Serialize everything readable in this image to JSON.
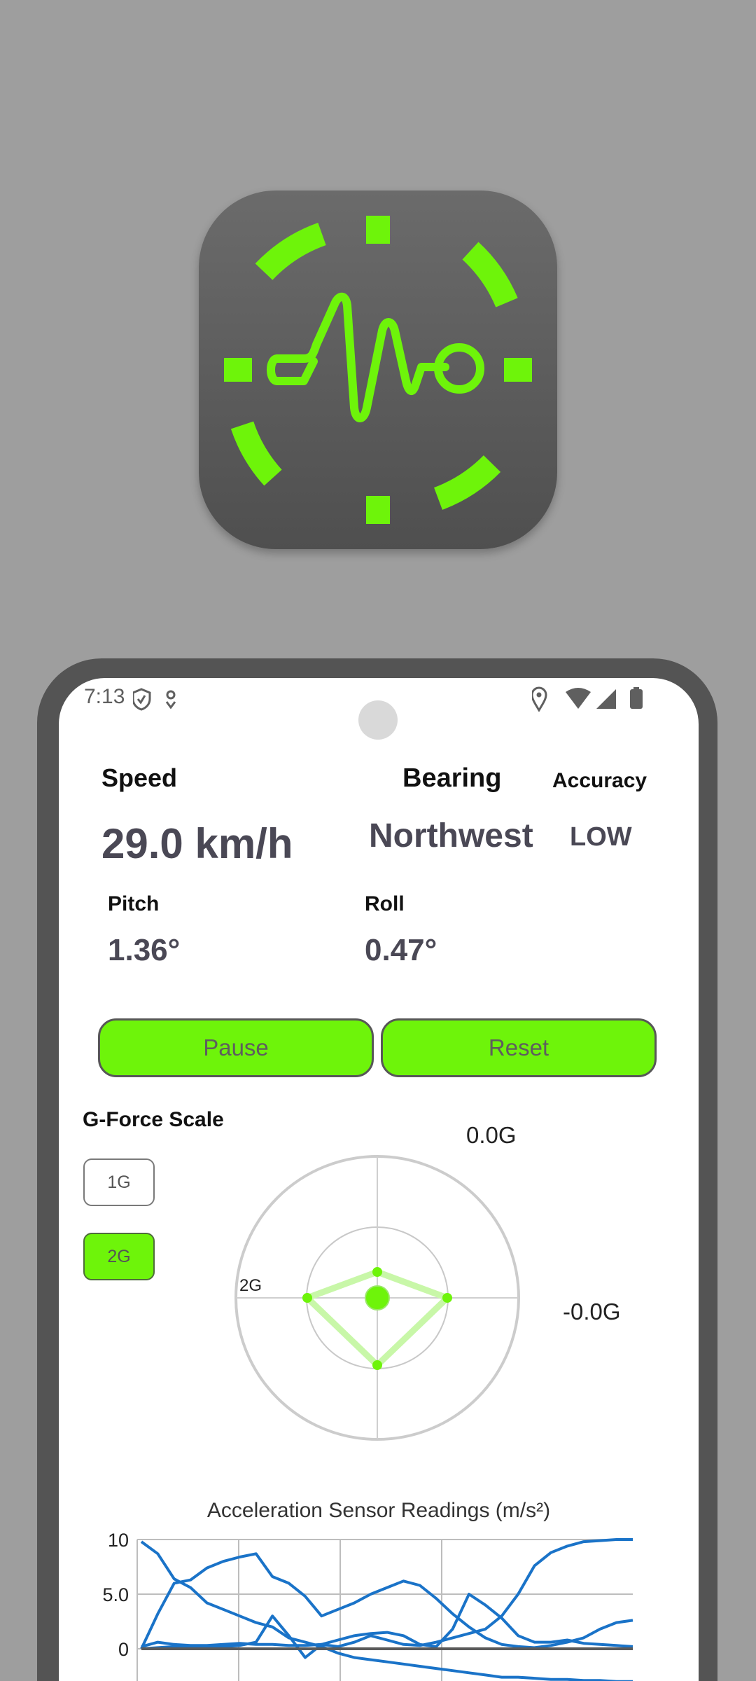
{
  "status_bar": {
    "time": "7:13"
  },
  "metrics": {
    "speed_label": "Speed",
    "speed_value": "29.0 km/h",
    "bearing_label": "Bearing",
    "bearing_value": "Northwest",
    "accuracy_label": "Accuracy",
    "accuracy_value": "LOW",
    "pitch_label": "Pitch",
    "pitch_value": "1.36°",
    "roll_label": "Roll",
    "roll_value": "0.47°"
  },
  "controls": {
    "pause_label": "Pause",
    "reset_label": "Reset"
  },
  "gforce": {
    "scale_title": "G-Force Scale",
    "scale_options": [
      "1G",
      "2G"
    ],
    "selected_scale": "2G",
    "top_readout": "0.0G",
    "side_readout": "-0.0G",
    "ring_label": "2G"
  },
  "chart_data": {
    "type": "line",
    "title": "Acceleration Sensor Readings (m/s²)",
    "y_tick_labels": [
      "10",
      "5.0",
      "0"
    ],
    "ylim": [
      0,
      10
    ],
    "grid": true,
    "series": [
      {
        "values": [
          9.8,
          8.7,
          6.4,
          5.6,
          4.2,
          3.6,
          3.0,
          2.4,
          2.0,
          1.0,
          0.6,
          0.2,
          -0.4,
          -0.8,
          -1.0,
          -1.2,
          -1.4,
          -1.6,
          -1.8,
          -2.0,
          -2.2,
          -2.4,
          -2.6,
          -2.6,
          -2.7,
          -2.8,
          -2.8,
          -2.9,
          -2.9,
          -3.0,
          -3.0
        ]
      },
      {
        "values": [
          0.0,
          3.2,
          6.0,
          6.3,
          7.4,
          8.0,
          8.4,
          8.7,
          6.6,
          6.0,
          4.8,
          3.0,
          3.6,
          4.2,
          5.0,
          5.6,
          6.2,
          5.8,
          4.6,
          3.2,
          2.0,
          1.0,
          0.4,
          0.2,
          0.1,
          0.3,
          0.6,
          1.0,
          1.8,
          2.4,
          2.6
        ]
      },
      {
        "values": [
          0.2,
          0.6,
          0.4,
          0.3,
          0.3,
          0.4,
          0.5,
          0.4,
          0.4,
          0.3,
          0.3,
          0.4,
          0.8,
          1.2,
          1.4,
          1.5,
          1.2,
          0.4,
          0.2,
          1.8,
          5.0,
          4.0,
          2.8,
          1.2,
          0.6,
          0.6,
          0.8,
          0.5,
          0.4,
          0.3,
          0.2
        ]
      },
      {
        "values": [
          0.0,
          0.1,
          0.2,
          0.2,
          0.1,
          0.2,
          0.3,
          0.6,
          3.0,
          1.2,
          -0.8,
          0.4,
          0.2,
          0.6,
          1.2,
          0.8,
          0.4,
          0.3,
          0.6,
          1.0,
          1.4,
          1.8,
          3.0,
          5.0,
          7.6,
          8.8,
          9.4,
          9.8,
          9.9,
          10.0,
          10.0
        ]
      },
      {
        "values": [
          0.0,
          0.0,
          0.0,
          0.0,
          0.0,
          0.0,
          0.0,
          0.0,
          0.0,
          0.0,
          0.0,
          0.0,
          0.0,
          0.0,
          0.0,
          0.0,
          0.0,
          0.0,
          0.0,
          0.0,
          0.0,
          0.0,
          0.0,
          0.0,
          0.0,
          0.0,
          0.0,
          0.0,
          0.0,
          0.0,
          0.0
        ]
      }
    ]
  }
}
